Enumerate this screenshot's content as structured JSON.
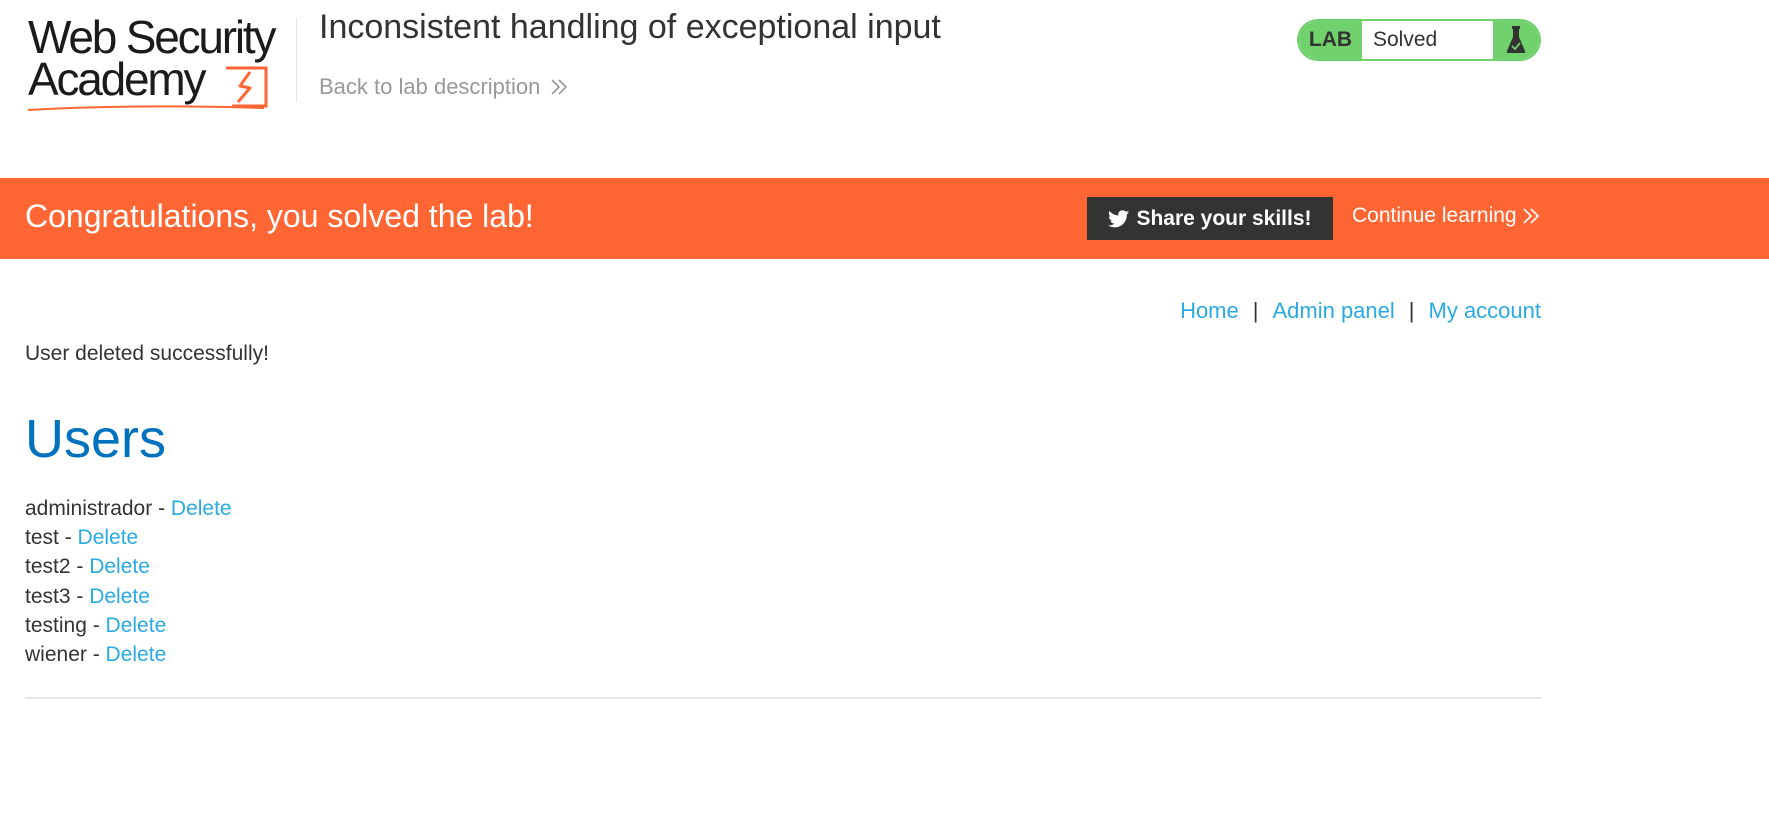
{
  "header": {
    "logo_text": "Web Security\nAcademy",
    "lab_title": "Inconsistent handling of exceptional input",
    "back_link": "Back to lab description",
    "lab_badge": {
      "label": "LAB",
      "status": "Solved",
      "icon": "flask-icon"
    }
  },
  "banner": {
    "message": "Congratulations, you solved the lab!",
    "share_button": "Share your skills!",
    "share_icon": "twitter-icon",
    "continue_link": "Continue learning"
  },
  "nav": {
    "home": "Home",
    "admin_panel": "Admin panel",
    "my_account": "My account",
    "separator": "|"
  },
  "main": {
    "status_message": "User deleted successfully!",
    "heading": "Users",
    "users": [
      {
        "name": "administrador",
        "separator": " - ",
        "action": "Delete"
      },
      {
        "name": "test",
        "separator": " - ",
        "action": "Delete"
      },
      {
        "name": "test2",
        "separator": " - ",
        "action": "Delete"
      },
      {
        "name": "test3",
        "separator": " - ",
        "action": "Delete"
      },
      {
        "name": "testing",
        "separator": " - ",
        "action": "Delete"
      },
      {
        "name": "wiener",
        "separator": " - ",
        "action": "Delete"
      }
    ]
  },
  "colors": {
    "brand_orange": "#ff6633",
    "solved_green": "#70d16d",
    "link_blue": "#29abe2",
    "heading_blue": "#0071bc",
    "dark": "#333332"
  }
}
